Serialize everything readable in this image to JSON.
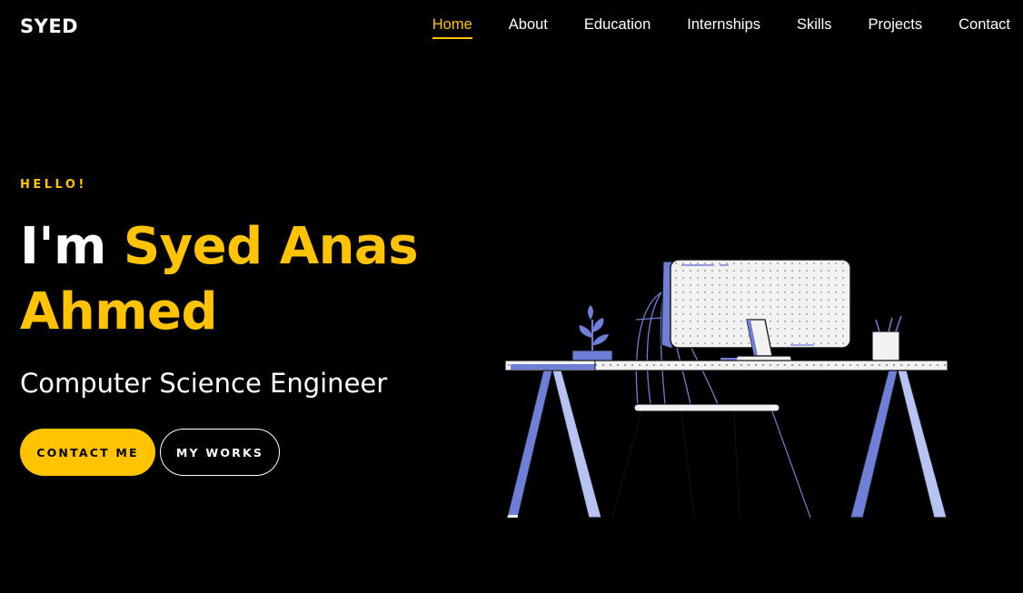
{
  "brand": {
    "logo": "SYED",
    "accent_color": "#ffc300",
    "background_color": "#000000"
  },
  "nav": {
    "items": [
      {
        "label": "Home",
        "active": true
      },
      {
        "label": "About",
        "active": false
      },
      {
        "label": "Education",
        "active": false
      },
      {
        "label": "Internships",
        "active": false
      },
      {
        "label": "Skills",
        "active": false
      },
      {
        "label": "Projects",
        "active": false
      },
      {
        "label": "Contact",
        "active": false
      }
    ]
  },
  "hero": {
    "greeting": "HELLO!",
    "intro": "I'm ",
    "name": "Syed Anas Ahmed",
    "role": "Computer Science Engineer",
    "buttons": {
      "contact": "CONTACT ME",
      "works": "MY WORKS"
    },
    "illustration": "desk-computer-illustration"
  }
}
